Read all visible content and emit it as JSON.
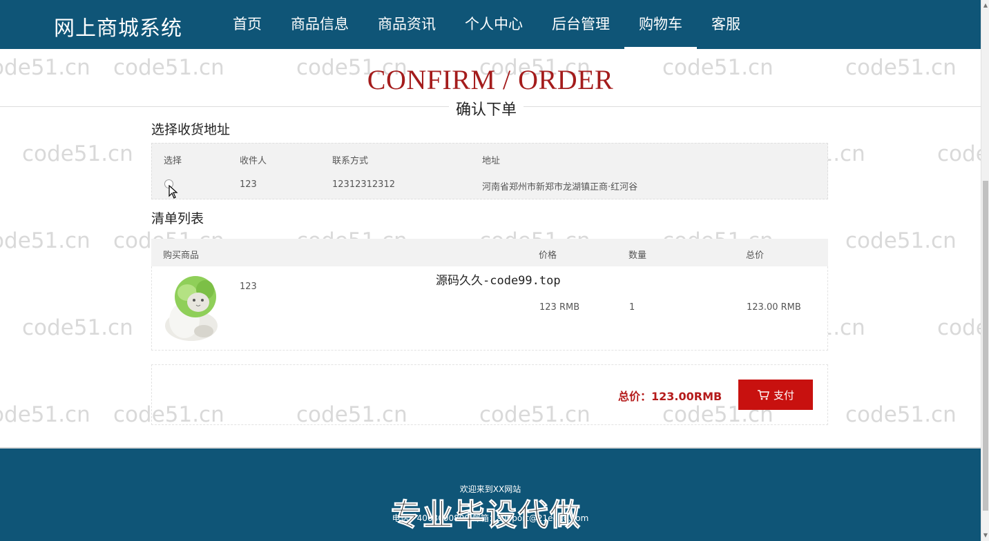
{
  "header": {
    "brand": "网上商城系统",
    "nav": [
      {
        "label": "首页"
      },
      {
        "label": "商品信息"
      },
      {
        "label": "商品资讯"
      },
      {
        "label": "个人中心"
      },
      {
        "label": "后台管理"
      },
      {
        "label": "购物车",
        "active": true
      },
      {
        "label": "客服"
      }
    ]
  },
  "page": {
    "title_en": "CONFIRM / ORDER",
    "title_cn": "确认下单"
  },
  "address": {
    "section_title": "选择收货地址",
    "columns": [
      "选择",
      "收件人",
      "联系方式",
      "地址"
    ],
    "row": {
      "name": "123",
      "phone": "12312312312",
      "address": "河南省郑州市新郑市龙湖镇正商·红河谷"
    }
  },
  "items": {
    "section_title": "清单列表",
    "columns": [
      "购买商品",
      "价格",
      "数量",
      "总价"
    ],
    "row": {
      "name": "123",
      "price": "123 RMB",
      "quantity": "1",
      "total": "123.00 RMB",
      "image_icon": "cabbage-cat-image"
    }
  },
  "promo_text": "源码久久-code99.top",
  "summary": {
    "total_label": "总价：123.00RMB",
    "pay_label": "支付",
    "pay_icon": "cart-icon"
  },
  "footer": {
    "welcome": "欢迎来到XX网站",
    "contact": "电话：4008000800  邮箱：support@21eduo.com",
    "overlay_text": "专业毕设代做"
  },
  "watermark": "code51.cn",
  "colors": {
    "nav_bg": "#0f5577",
    "title_red": "#a41c1c",
    "pay_button": "#c8110f",
    "total_red": "#b51b1b"
  }
}
